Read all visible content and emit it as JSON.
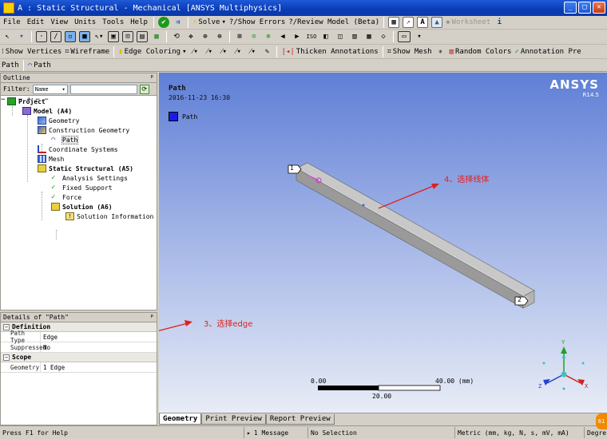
{
  "window": {
    "title": "A : Static Structural - Mechanical [ANSYS Multiphysics]",
    "min_glyph": "_",
    "max_glyph": "□",
    "close_glyph": "✕"
  },
  "menu": [
    "File",
    "Edit",
    "View",
    "Units",
    "Tools",
    "Help"
  ],
  "toolbar1": {
    "solve": "Solve",
    "show_errors": "?/Show Errors",
    "review_model": "?/Review Model (Beta)",
    "worksheet": "Worksheet"
  },
  "toolbar3": {
    "show_vertices": "Show Vertices",
    "wireframe": "Wireframe",
    "edge_coloring": "Edge Coloring",
    "thicken": "Thicken Annotations",
    "show_mesh": "Show Mesh",
    "random_colors": "Random Colors",
    "annotation_pre": "Annotation Pre"
  },
  "context_toolbar": {
    "path_label": "Path",
    "path_button": "Path"
  },
  "outline": {
    "header": "Outline",
    "filter_label": "Filter:",
    "filter_value": "Name",
    "tree": {
      "project": "Project",
      "model": "Model (A4)",
      "geometry": "Geometry",
      "construction_geometry": "Construction Geometry",
      "path": "Path",
      "coordinate_systems": "Coordinate Systems",
      "mesh": "Mesh",
      "static_structural": "Static Structural (A5)",
      "analysis_settings": "Analysis Settings",
      "fixed_support": "Fixed Support",
      "force": "Force",
      "solution": "Solution (A6)",
      "solution_information": "Solution Information"
    }
  },
  "details": {
    "header": "Details of \"Path\"",
    "definition": "Definition",
    "path_type_k": "Path Type",
    "path_type_v": "Edge",
    "suppressed_k": "Suppressed",
    "suppressed_v": "No",
    "scope": "Scope",
    "geometry_k": "Geometry",
    "geometry_v": "1 Edge"
  },
  "viewport": {
    "title": "Path",
    "date": "2016-11-23 16:30",
    "legend": "Path",
    "logo": "ANSYS",
    "version": "R14.5",
    "marker1": "1",
    "marker2": "2",
    "scale_left": "0.00",
    "scale_right": "40.00 (mm)",
    "scale_mid": "20.00",
    "triad_x": "X",
    "triad_y": "Y",
    "triad_z": "Z"
  },
  "annotations": {
    "edge": "3、选择edge",
    "line_body": "4、选择线体"
  },
  "tabs": [
    "Geometry",
    "Print Preview",
    "Report Preview"
  ],
  "status": {
    "help": "Press F1 for Help",
    "messages": "1 Message",
    "selection": "No Selection",
    "units": "Metric (mm, kg, N, s, mV, mA)",
    "degrees": "Degre",
    "badge": "61"
  },
  "colors": {
    "accent_blue": "#1a1ae8",
    "annotation_red": "#e02020",
    "check_green": "#1c9a1c"
  }
}
